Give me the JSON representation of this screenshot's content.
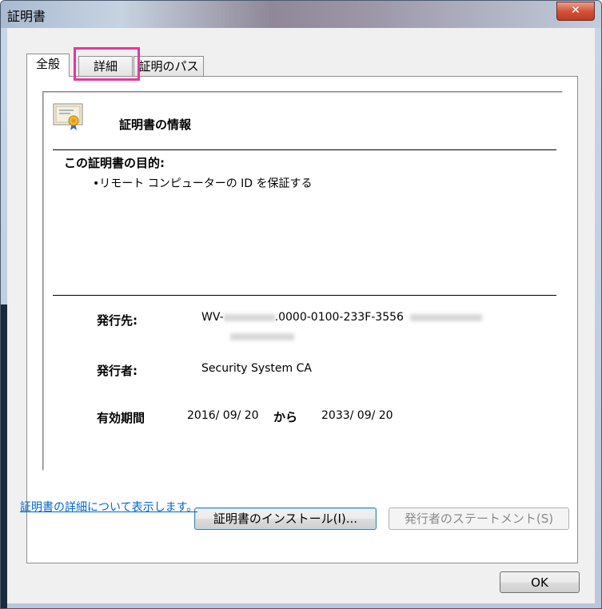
{
  "window": {
    "title": "証明書",
    "close_icon": "close-icon"
  },
  "tabs": [
    {
      "label": "全般",
      "active": true
    },
    {
      "label": "詳細",
      "active": false
    },
    {
      "label": "証明のパス",
      "active": false
    }
  ],
  "info": {
    "title": "証明書の情報",
    "purpose_heading": "この証明書の目的:",
    "purpose_item": "•リモート コンピューターの ID を保証する"
  },
  "fields": {
    "issued_to_label": "発行先:",
    "issued_to_prefix": "WV-",
    "issued_to_suffix": ".0000-0100-233F-3556",
    "issued_by_label": "発行者:",
    "issued_by_value": "Security System CA",
    "validity_label": "有効期間",
    "valid_from": "2016/ 09/ 20",
    "valid_sep": "から",
    "valid_to": "2033/ 09/ 20"
  },
  "buttons": {
    "install": "証明書のインストール(I)...",
    "statement": "発行者のステートメント(S)",
    "ok": "OK"
  },
  "link": {
    "text": "証明書の詳細について表示します。"
  }
}
